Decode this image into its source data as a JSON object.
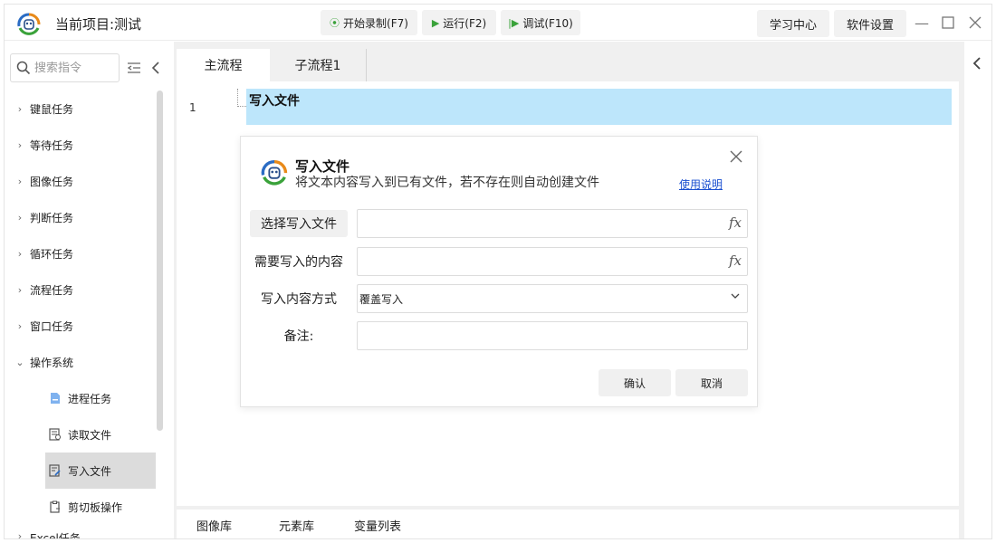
{
  "titlebar": {
    "project_title": "当前项目:测试",
    "record_label": "开始录制(F7)",
    "run_label": "运行(F2)",
    "debug_label": "调试(F10)",
    "learn_label": "学习中心",
    "settings_label": "软件设置"
  },
  "sidebar": {
    "search_placeholder": "搜索指令",
    "categories": [
      {
        "label": "键鼠任务"
      },
      {
        "label": "等待任务"
      },
      {
        "label": "图像任务"
      },
      {
        "label": "判断任务"
      },
      {
        "label": "循环任务"
      },
      {
        "label": "流程任务"
      },
      {
        "label": "窗口任务"
      },
      {
        "label": "操作系统"
      }
    ],
    "subitems": [
      {
        "label": "进程任务"
      },
      {
        "label": "读取文件"
      },
      {
        "label": "写入文件",
        "selected": true
      },
      {
        "label": "剪切板操作"
      }
    ],
    "partial_item": "Excel任务"
  },
  "tabs": {
    "main": "主流程",
    "sub": "子流程1"
  },
  "editor": {
    "line_number": "1",
    "step_text": "写入文件"
  },
  "bottom_tabs": {
    "image_lib": "图像库",
    "element_lib": "元素库",
    "var_list": "变量列表"
  },
  "dialog": {
    "title": "写入文件",
    "description": "将文本内容写入到已有文件，若不存在则自动创建文件",
    "help_link": "使用说明",
    "select_file_label": "选择写入文件",
    "content_label": "需要写入的内容",
    "mode_label": "写入内容方式",
    "mode_value": "覆盖写入",
    "note_label": "备注:",
    "fx_symbol": "fx",
    "confirm_label": "确认",
    "cancel_label": "取消"
  },
  "colors": {
    "selection_blue": "#bde6fb",
    "link_blue": "#1a4fd0",
    "run_green": "#3aa23a"
  }
}
